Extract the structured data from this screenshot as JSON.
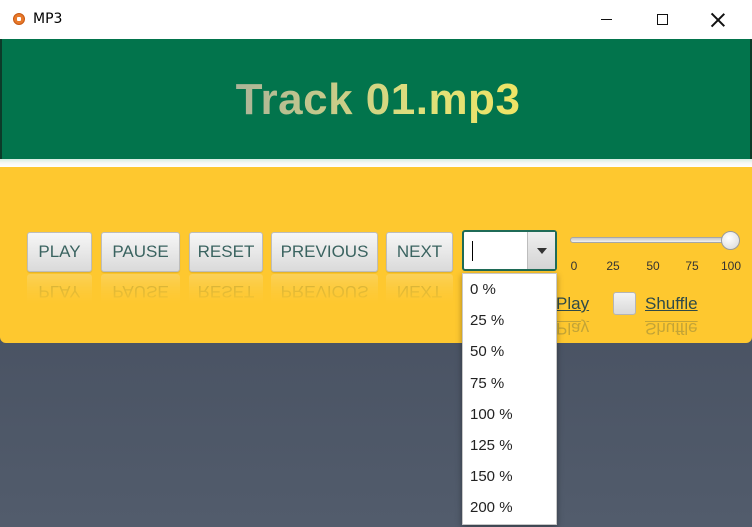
{
  "window": {
    "title": "MP3"
  },
  "player": {
    "track_title": "Track 01.mp3"
  },
  "buttons": {
    "play": "PLAY",
    "pause": "PAUSE",
    "reset": "RESET",
    "previous": "PREVIOUS",
    "next": "NEXT"
  },
  "speed_combo": {
    "value": "",
    "options": [
      "0 %",
      "25 %",
      "50 %",
      "75 %",
      "100 %",
      "125 %",
      "150 %",
      "200 %"
    ]
  },
  "volume_slider": {
    "ticks": [
      "0",
      "25",
      "50",
      "75",
      "100"
    ],
    "value": 100
  },
  "options": {
    "autoplay_label": "Play",
    "shuffle_label": "Shuffle",
    "shuffle_checked": false
  },
  "colors": {
    "header_bg": "#02744c",
    "controls_bg": "#fec82f",
    "combo_border": "#1f6b57"
  },
  "icons": {
    "app": "speaker-icon",
    "minimize": "minimize-icon",
    "maximize": "maximize-icon",
    "close": "close-icon",
    "combo_arrow": "chevron-down-icon"
  }
}
